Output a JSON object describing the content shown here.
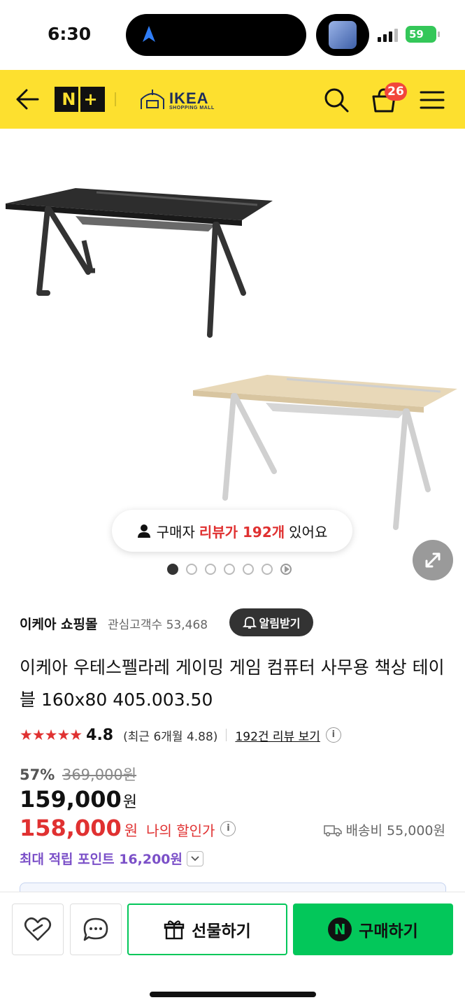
{
  "status_bar": {
    "time": "6:30",
    "battery": "59"
  },
  "header": {
    "logo_n": "N",
    "logo_plus": "+",
    "ikea_title": "IKEA",
    "ikea_subtitle": "SHOPPING MALL",
    "cart_count": "26"
  },
  "gallery": {
    "review_pill": {
      "prefix": "구매자",
      "highlight": "리뷰가 192개",
      "suffix": "있어요"
    },
    "dot_count": 7,
    "active_index": 0
  },
  "store": {
    "name": "이케아 쇼핑몰",
    "interest_label": "관심고객수 53,468",
    "alarm_label": "알림받기"
  },
  "product": {
    "title": "이케아 우테스펠라레 게이밍 게임 컴퓨터 사무용 책상 테이블 160x80 405.003.50",
    "stars": "★★★★★",
    "rating": "4.8",
    "recent_rating": "(최근 6개월 4.88)",
    "review_link": "192건 리뷰 보기",
    "discount_pct": "57%",
    "original_price": "369,000원",
    "price": "159,000",
    "price_unit": "원",
    "my_price": "158,000",
    "my_price_unit": "원",
    "my_price_label": "나의 할인가",
    "shipping": "배송비 55,000원",
    "points": "최대 적립 포인트 16,200원"
  },
  "bottom_bar": {
    "gift_label": "선물하기",
    "buy_label": "구매하기",
    "buy_badge": "N"
  },
  "colors": {
    "brand_yellow": "#fde02f",
    "naver_green": "#03c75a",
    "sale_red": "#e03131",
    "points_purple": "#7b50c8"
  }
}
